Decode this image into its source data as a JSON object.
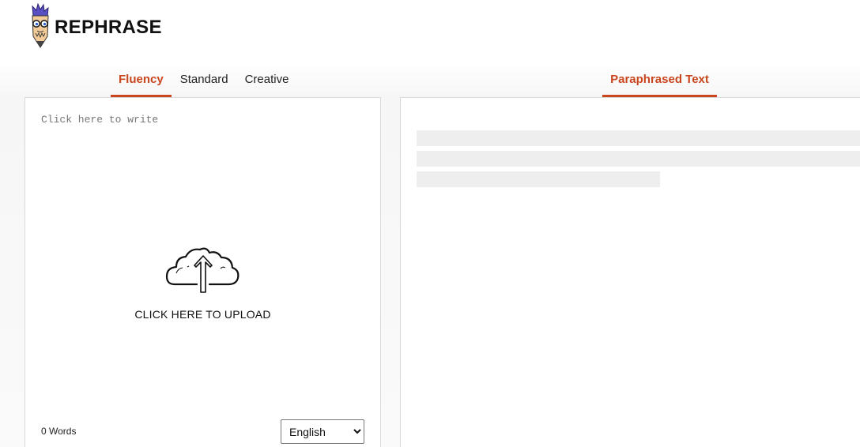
{
  "header": {
    "brand": "REPHRASE",
    "logo_icon": "pencil-mascot-icon"
  },
  "mode_tabs": [
    {
      "label": "Fluency",
      "active": true
    },
    {
      "label": "Standard",
      "active": false
    },
    {
      "label": "Creative",
      "active": false
    }
  ],
  "input": {
    "placeholder": "Click here to write",
    "upload_icon": "cloud-upload-icon",
    "upload_label": "CLICK HERE TO UPLOAD",
    "word_count": "0 Words",
    "language": {
      "selected": "English"
    }
  },
  "output": {
    "tab_label": "Paraphrased Text",
    "state": "loading"
  },
  "colors": {
    "accent": "#c9461e",
    "border": "#d9d9d9",
    "skeleton": "#eeeeee"
  }
}
